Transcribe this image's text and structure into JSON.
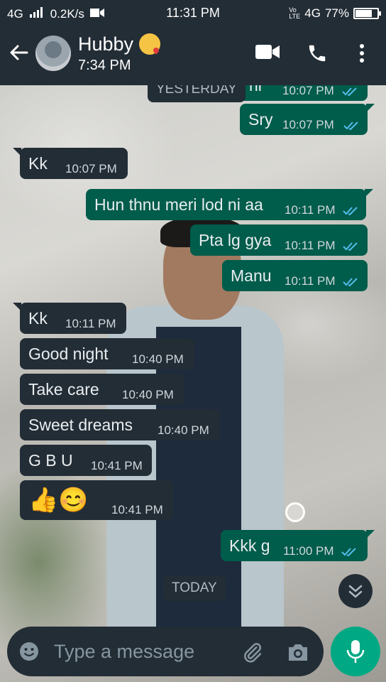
{
  "status_bar": {
    "network_left": "4G",
    "speed": "0.2K/s",
    "time": "11:31 PM",
    "network_right": "4G",
    "volte": "Vo LTE",
    "battery": "77%",
    "battery_level": 0.77
  },
  "header": {
    "contact_name": "Hubby",
    "last_seen": "7:34 PM",
    "icons": [
      "back-arrow-icon",
      "video-call-icon",
      "voice-call-icon",
      "more-options-icon"
    ]
  },
  "chat": {
    "day_chips": {
      "yesterday": "YESTERDAY",
      "today": "TODAY"
    },
    "partial_top": {
      "text": "Ji hi",
      "time": "10:07 PM"
    },
    "messages": [
      {
        "dir": "out",
        "text": "Sry",
        "time": "10:07 PM"
      },
      {
        "dir": "in",
        "text": "Kk",
        "time": "10:07 PM"
      },
      {
        "dir": "out",
        "text": "Hun thnu meri lod ni aa",
        "time": "10:11 PM"
      },
      {
        "dir": "out",
        "text": "Pta lg gya",
        "time": "10:11 PM"
      },
      {
        "dir": "out",
        "text": "Manu",
        "time": "10:11 PM"
      },
      {
        "dir": "in",
        "text": "Kk",
        "time": "10:11 PM"
      },
      {
        "dir": "in",
        "text": "Good night",
        "time": "10:40 PM"
      },
      {
        "dir": "in",
        "text": "Take care",
        "time": "10:40 PM"
      },
      {
        "dir": "in",
        "text": "Sweet dreams",
        "time": "10:40 PM"
      },
      {
        "dir": "in",
        "text": "G B U",
        "time": "10:41 PM"
      },
      {
        "dir": "in",
        "text": "👍😊",
        "time": "10:41 PM"
      },
      {
        "dir": "out",
        "text": "Kkk g",
        "time": "11:00 PM"
      }
    ]
  },
  "input": {
    "placeholder": "Type a message"
  },
  "colors": {
    "header_bg": "#232d36",
    "incoming_bubble": "#232d36",
    "outgoing_bubble": "#005c4b",
    "read_ticks": "#53bdeb",
    "mic_button": "#00a884"
  }
}
